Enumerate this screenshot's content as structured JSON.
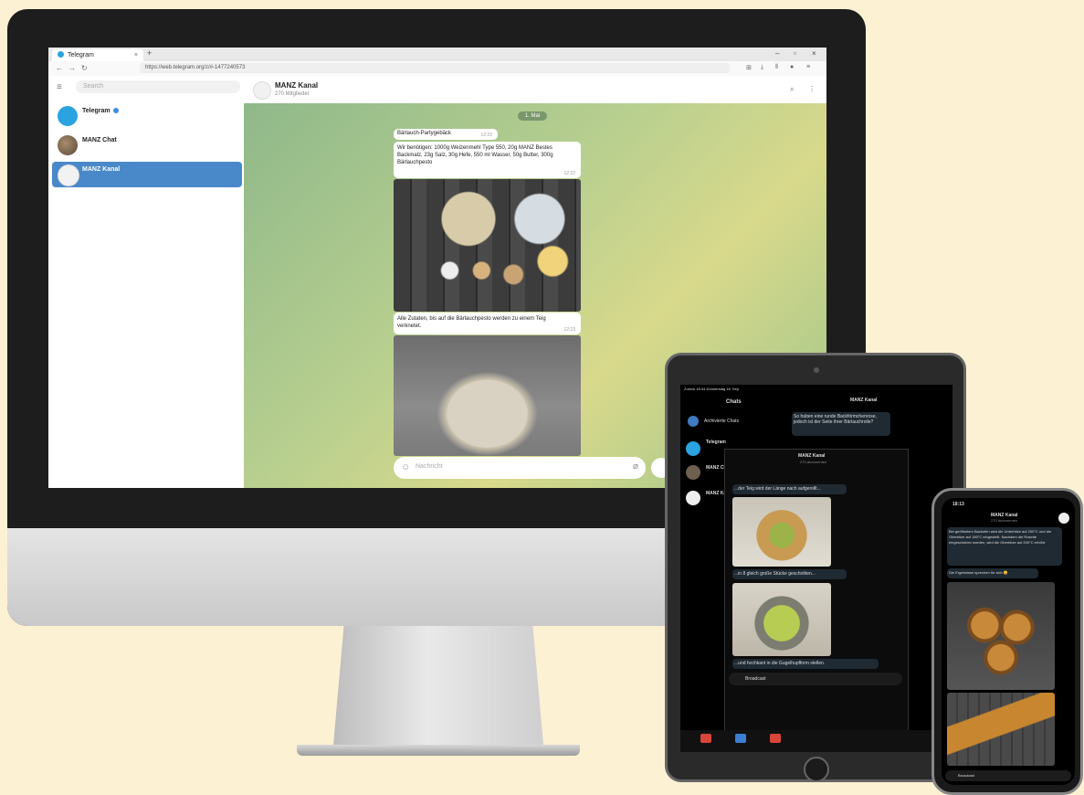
{
  "browser": {
    "tab_title": "Telegram",
    "tab_close": "×",
    "new_tab": "+",
    "url": "https://web.telegram.org/z/#-1477240573",
    "window_controls": [
      "–",
      "▫",
      "×"
    ],
    "nav": [
      "←",
      "→",
      "↻"
    ]
  },
  "telegram": {
    "search_placeholder": "Search",
    "chats": [
      {
        "name": "Telegram",
        "verified": true,
        "active": false,
        "avatar_color": "#2aa3e0"
      },
      {
        "name": "MANZ Chat",
        "verified": false,
        "active": false,
        "avatar_color": "#7a6a58"
      },
      {
        "name": "MANZ Kanal",
        "verified": false,
        "active": true,
        "avatar_color": "#f2f2f2"
      }
    ],
    "header": {
      "title": "MANZ Kanal",
      "subtitle": "270 Mitglieder"
    },
    "date_pill": "1. Mai",
    "messages": [
      {
        "text": "Bärlauch-Partygebäck",
        "time": "12:22"
      },
      {
        "text": "Wir benötigen: 1000g Weizenmehl Type 550, 20g MANZ Bestes Backmalz, 23g Salz, 30g Hefe, 550 ml Wasser, 50g Butter, 300g Bärlauchpesto",
        "time": "12:22"
      },
      {
        "caption": "Alle Zutaten, bis auf die Bärlauchpesto werden zu einem Teig verknetet.",
        "time": "12:23"
      }
    ],
    "composer_placeholder": "Nachricht",
    "accent": "#4a89c9"
  },
  "ipad": {
    "status_left": "Zurück 18:44 Donnerstag 18. Sep",
    "chats_title": "Chats",
    "archived": "Archivierte Chats",
    "chat_list": [
      "Telegram",
      "MANZ Chat",
      "MANZ Kanal"
    ],
    "channel_title": "MANZ Kanal",
    "channel_sub": "270 Abonnenten",
    "top_bubble": "So haben eine runde Backförmchenrose, jedoch ist der Seite ihrer Bärlauchrolle?",
    "messages": [
      "...der Teig wird der Länge nach aufgerollt...",
      "...in 8 gleich große Stücke geschnitten...",
      "...und hochkant in die Gugelhupfform stellen."
    ],
    "composer": "Broadcast",
    "tabs": [
      "Kontakte",
      "Chats",
      "Einstellungen"
    ]
  },
  "iphone": {
    "time": "18:13",
    "title": "MANZ Kanal",
    "subtitle": "270 Abonnenten",
    "bubble1": "Bei geöffnetem Backofen wird die Unterhitze auf 200°C und die Oberhitze auf 180°C eingestellt. Nachdem die Rosette eingeschoben worden, wird die Oberhitze auf 200°C erhöht.",
    "bubble2": "Die Ergebnisse sprechen für sich 😋",
    "composer": "Broadcast"
  }
}
